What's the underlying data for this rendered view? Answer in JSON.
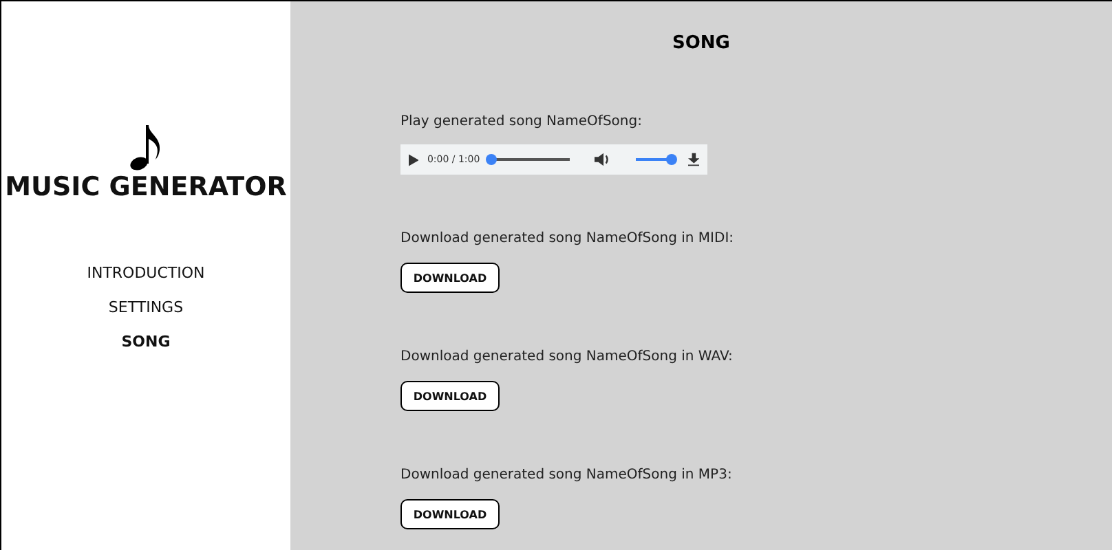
{
  "app_title": "MUSIC GENERATOR",
  "nav": [
    {
      "label": "INTRODUCTION",
      "selected": false
    },
    {
      "label": "SETTINGS",
      "selected": false
    },
    {
      "label": "SONG",
      "selected": true
    }
  ],
  "page_title": "SONG",
  "player": {
    "label": "Play generated song NameOfSong:",
    "time": "0:00 / 1:00",
    "progress": {
      "level": 0
    },
    "volume": {
      "level": 1
    }
  },
  "downloads": [
    {
      "label": "Download generated song NameOfSong in MIDI:",
      "button": "DOWNLOAD"
    },
    {
      "label": "Download generated song NameOfSong in WAV:",
      "button": "DOWNLOAD"
    },
    {
      "label": "Download generated song NameOfSong in MP3:",
      "button": "DOWNLOAD"
    }
  ]
}
